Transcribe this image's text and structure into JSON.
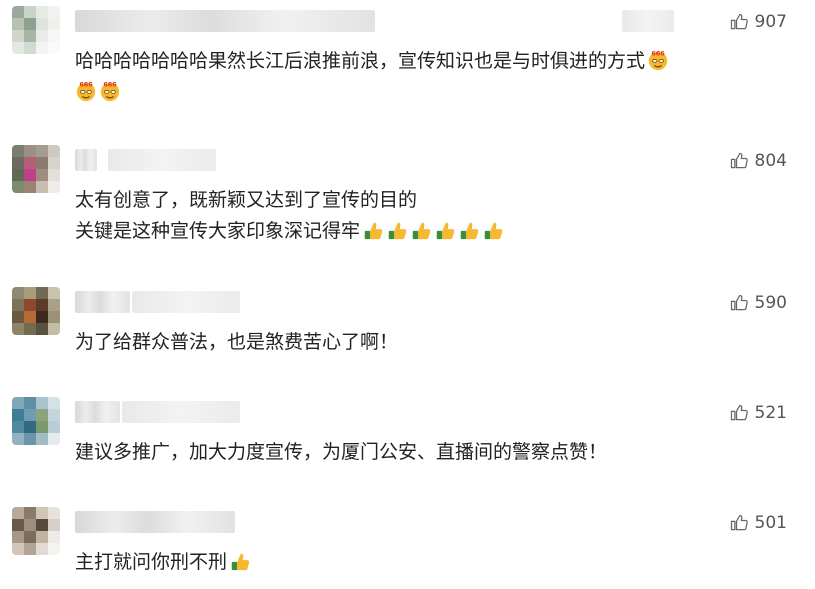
{
  "comments": [
    {
      "likes": "907",
      "lines": [
        "哈哈哈哈哈哈哈果然长江后浪推前浪，宣传知识也是与时俱进的方式"
      ],
      "emoji_trailing_first_line": "666-face-emoji",
      "emoji_second_line": [
        "666-face-emoji",
        "666-face-emoji"
      ]
    },
    {
      "likes": "804",
      "lines": [
        "太有创意了，既新颖又达到了宣传的目的",
        "关键是这种宣传大家印象深记得牢"
      ],
      "emoji_trailing": [
        "thumbs-up-emoji",
        "thumbs-up-emoji",
        "thumbs-up-emoji",
        "thumbs-up-emoji",
        "thumbs-up-emoji",
        "thumbs-up-emoji"
      ]
    },
    {
      "likes": "590",
      "lines": [
        "为了给群众普法，也是煞费苦心了啊！"
      ]
    },
    {
      "likes": "521",
      "lines": [
        "建议多推广，加大力度宣传，为厦门公安、直播间的警察点赞！"
      ]
    },
    {
      "likes": "501",
      "lines": [
        "主打就问你刑不刑"
      ],
      "emoji_trailing": [
        "thumbs-up-emoji"
      ]
    }
  ],
  "icons": {
    "like": "thumbs-up-outline-icon"
  },
  "colors": {
    "text": "#222222",
    "likes": "#555555",
    "emoji_yellow": "#f5b82e",
    "emoji_green": "#3a8f3a"
  }
}
